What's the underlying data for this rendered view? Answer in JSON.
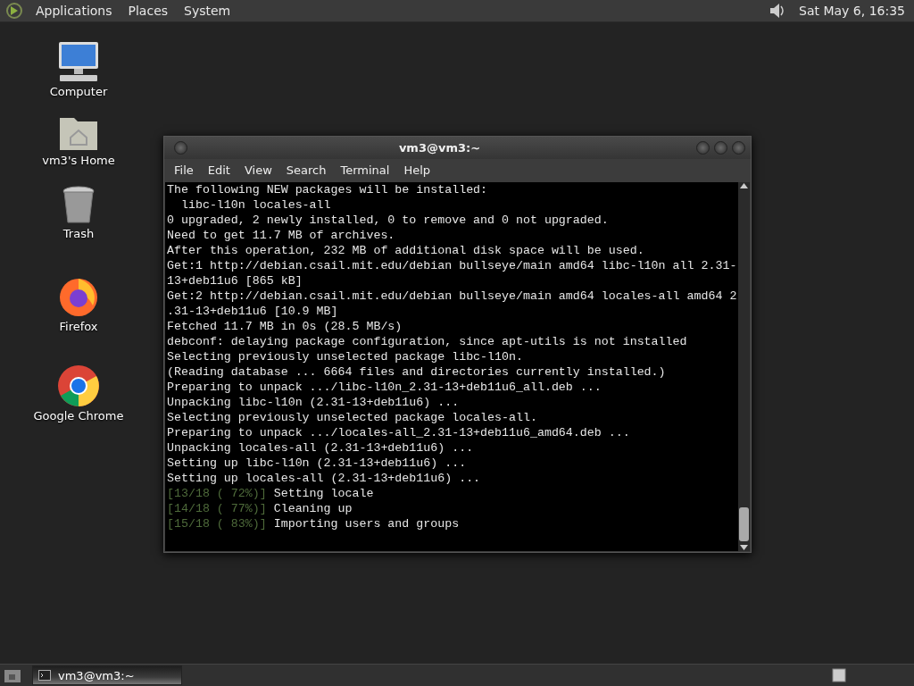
{
  "top_panel": {
    "menus": [
      {
        "label": "Applications"
      },
      {
        "label": "Places"
      },
      {
        "label": "System"
      }
    ],
    "clock": "Sat May  6, 16:35"
  },
  "desktop_icons": [
    {
      "kind": "computer",
      "label": "Computer"
    },
    {
      "kind": "home",
      "label": "vm3's Home"
    },
    {
      "kind": "trash",
      "label": "Trash"
    },
    {
      "kind": "firefox",
      "label": "Firefox"
    },
    {
      "kind": "chrome",
      "label": "Google Chrome"
    }
  ],
  "window": {
    "title": "vm3@vm3:~",
    "menus": [
      {
        "label": "File"
      },
      {
        "label": "Edit"
      },
      {
        "label": "View"
      },
      {
        "label": "Search"
      },
      {
        "label": "Terminal"
      },
      {
        "label": "Help"
      }
    ],
    "lines": [
      {
        "text": "The following NEW packages will be installed:"
      },
      {
        "text": "  libc-l10n locales-all"
      },
      {
        "text": "0 upgraded, 2 newly installed, 0 to remove and 0 not upgraded."
      },
      {
        "text": "Need to get 11.7 MB of archives."
      },
      {
        "text": "After this operation, 232 MB of additional disk space will be used."
      },
      {
        "text": "Get:1 http://debian.csail.mit.edu/debian bullseye/main amd64 libc-l10n all 2.31-"
      },
      {
        "text": "13+deb11u6 [865 kB]"
      },
      {
        "text": "Get:2 http://debian.csail.mit.edu/debian bullseye/main amd64 locales-all amd64 2"
      },
      {
        "text": ".31-13+deb11u6 [10.9 MB]"
      },
      {
        "text": "Fetched 11.7 MB in 0s (28.5 MB/s)"
      },
      {
        "text": "debconf: delaying package configuration, since apt-utils is not installed"
      },
      {
        "text": "Selecting previously unselected package libc-l10n."
      },
      {
        "text": "(Reading database ... 6664 files and directories currently installed.)"
      },
      {
        "text": "Preparing to unpack .../libc-l10n_2.31-13+deb11u6_all.deb ..."
      },
      {
        "text": "Unpacking libc-l10n (2.31-13+deb11u6) ..."
      },
      {
        "text": "Selecting previously unselected package locales-all."
      },
      {
        "text": "Preparing to unpack .../locales-all_2.31-13+deb11u6_amd64.deb ..."
      },
      {
        "text": "Unpacking locales-all (2.31-13+deb11u6) ..."
      },
      {
        "text": "Setting up libc-l10n (2.31-13+deb11u6) ..."
      },
      {
        "text": "Setting up locales-all (2.31-13+deb11u6) ..."
      },
      {
        "progress": "[13/18 ( 72%)]",
        "text": "Setting locale"
      },
      {
        "progress": "[14/18 ( 77%)]",
        "text": "Cleaning up"
      },
      {
        "progress": "[15/18 ( 83%)]",
        "text": "Importing users and groups"
      }
    ]
  },
  "taskbar": {
    "tasks": [
      {
        "label": "vm3@vm3:~",
        "selected": true
      }
    ]
  }
}
